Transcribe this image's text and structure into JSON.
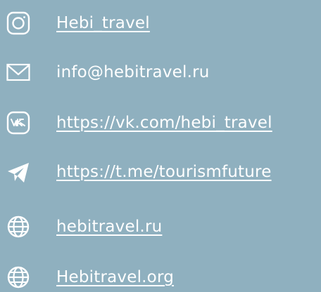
{
  "contacts": [
    {
      "icon": "instagram-icon",
      "text": "Hebi_travel"
    },
    {
      "icon": "mail-icon",
      "text": "info@hebitravel.ru"
    },
    {
      "icon": "vk-icon",
      "text": "https://vk.com/hebi_travel"
    },
    {
      "icon": "telegram-icon",
      "text": "https://t.me/tourismfuture"
    },
    {
      "icon": "globe-icon",
      "text": "hebitravel.ru"
    },
    {
      "icon": "globe-icon",
      "text": "Hebitravel.org"
    }
  ],
  "colors": {
    "background": "#8fb0bf",
    "foreground": "#ffffff"
  }
}
